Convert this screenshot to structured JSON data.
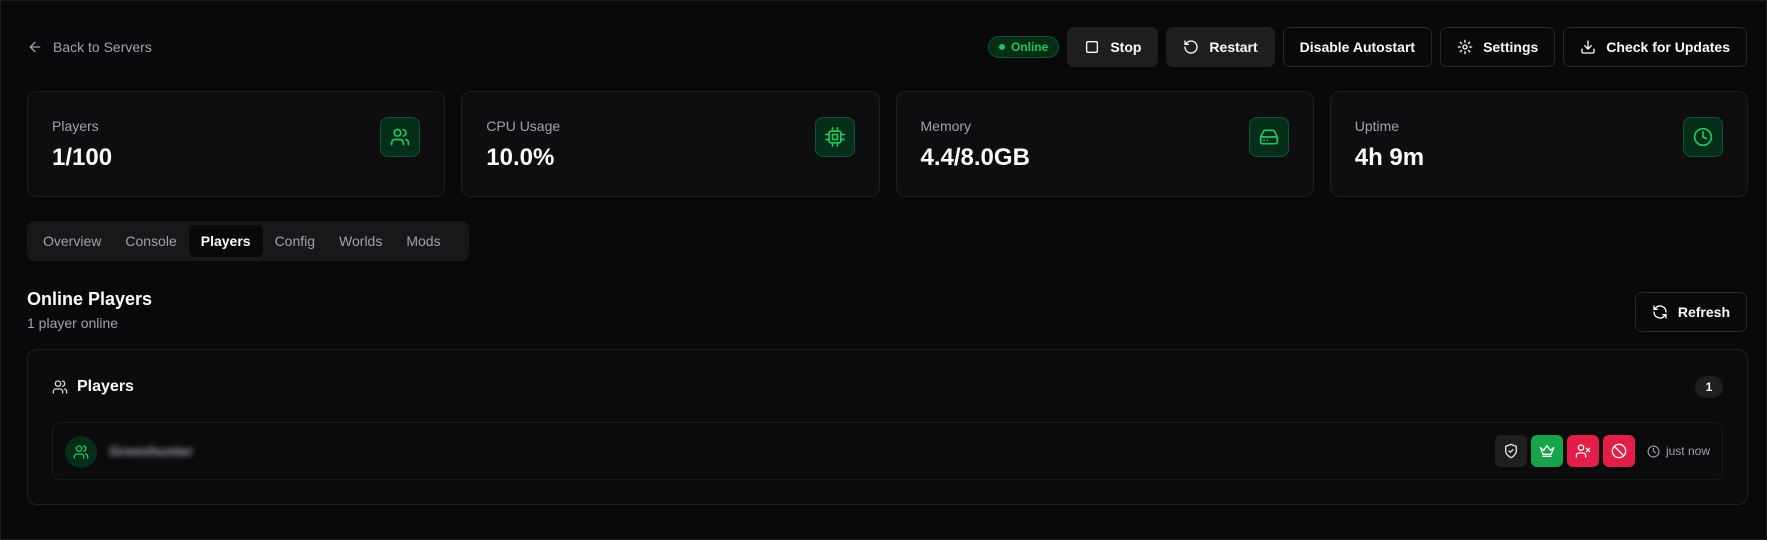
{
  "header": {
    "back_label": "Back to Servers",
    "status": "Online",
    "buttons": {
      "stop": "Stop",
      "restart": "Restart",
      "disable_autostart": "Disable Autostart",
      "settings": "Settings",
      "check_updates": "Check for Updates"
    }
  },
  "stats": [
    {
      "label": "Players",
      "value": "1/100",
      "icon": "users-icon"
    },
    {
      "label": "CPU Usage",
      "value": "10.0%",
      "icon": "cpu-icon"
    },
    {
      "label": "Memory",
      "value": "4.4/8.0GB",
      "icon": "hard-drive-icon"
    },
    {
      "label": "Uptime",
      "value": "4h 9m",
      "icon": "clock-icon"
    }
  ],
  "tabs": [
    {
      "label": "Overview"
    },
    {
      "label": "Console"
    },
    {
      "label": "Players",
      "active": true
    },
    {
      "label": "Config"
    },
    {
      "label": "Worlds"
    },
    {
      "label": "Mods"
    }
  ],
  "section": {
    "title": "Online Players",
    "subtitle": "1 player online",
    "refresh_label": "Refresh"
  },
  "panel": {
    "title": "Players",
    "count": "1",
    "players": [
      {
        "name": "Greenhunter",
        "last_seen": "just now"
      }
    ]
  },
  "colors": {
    "accent": "#22c55e",
    "danger": "#e11d48",
    "background": "#09090b"
  }
}
